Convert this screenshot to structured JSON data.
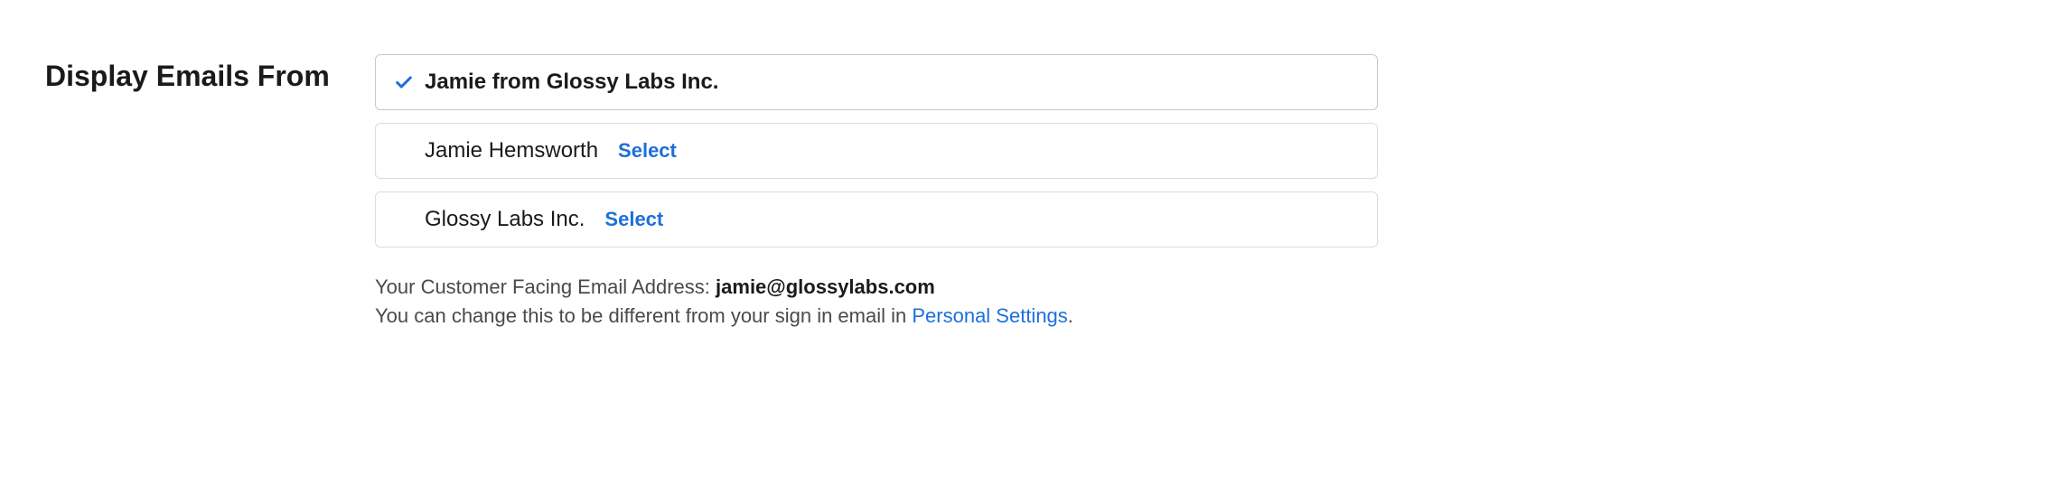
{
  "heading": "Display Emails From",
  "options": [
    {
      "label": "Jamie from Glossy Labs Inc.",
      "selected": true
    },
    {
      "label": "Jamie Hemsworth",
      "selected": false
    },
    {
      "label": "Glossy Labs Inc.",
      "selected": false
    }
  ],
  "select_label": "Select",
  "footer": {
    "email_prefix": "Your Customer Facing Email Address: ",
    "email": "jamie@glossylabs.com",
    "change_text_before": "You can change this to be different from your sign in email in ",
    "settings_link_label": "Personal Settings",
    "change_text_after": "."
  },
  "colors": {
    "link": "#1d6fdc",
    "border": "#dcdcdc",
    "text": "#1a1a1a"
  }
}
